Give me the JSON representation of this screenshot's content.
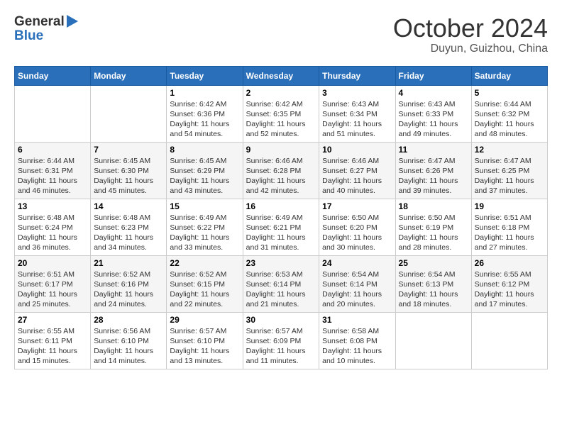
{
  "logo": {
    "text_general": "General",
    "text_blue": "Blue"
  },
  "title": "October 2024",
  "location": "Duyun, Guizhou, China",
  "weekdays": [
    "Sunday",
    "Monday",
    "Tuesday",
    "Wednesday",
    "Thursday",
    "Friday",
    "Saturday"
  ],
  "weeks": [
    [
      {
        "day": "",
        "info": ""
      },
      {
        "day": "",
        "info": ""
      },
      {
        "day": "1",
        "info": "Sunrise: 6:42 AM\nSunset: 6:36 PM\nDaylight: 11 hours and 54 minutes."
      },
      {
        "day": "2",
        "info": "Sunrise: 6:42 AM\nSunset: 6:35 PM\nDaylight: 11 hours and 52 minutes."
      },
      {
        "day": "3",
        "info": "Sunrise: 6:43 AM\nSunset: 6:34 PM\nDaylight: 11 hours and 51 minutes."
      },
      {
        "day": "4",
        "info": "Sunrise: 6:43 AM\nSunset: 6:33 PM\nDaylight: 11 hours and 49 minutes."
      },
      {
        "day": "5",
        "info": "Sunrise: 6:44 AM\nSunset: 6:32 PM\nDaylight: 11 hours and 48 minutes."
      }
    ],
    [
      {
        "day": "6",
        "info": "Sunrise: 6:44 AM\nSunset: 6:31 PM\nDaylight: 11 hours and 46 minutes."
      },
      {
        "day": "7",
        "info": "Sunrise: 6:45 AM\nSunset: 6:30 PM\nDaylight: 11 hours and 45 minutes."
      },
      {
        "day": "8",
        "info": "Sunrise: 6:45 AM\nSunset: 6:29 PM\nDaylight: 11 hours and 43 minutes."
      },
      {
        "day": "9",
        "info": "Sunrise: 6:46 AM\nSunset: 6:28 PM\nDaylight: 11 hours and 42 minutes."
      },
      {
        "day": "10",
        "info": "Sunrise: 6:46 AM\nSunset: 6:27 PM\nDaylight: 11 hours and 40 minutes."
      },
      {
        "day": "11",
        "info": "Sunrise: 6:47 AM\nSunset: 6:26 PM\nDaylight: 11 hours and 39 minutes."
      },
      {
        "day": "12",
        "info": "Sunrise: 6:47 AM\nSunset: 6:25 PM\nDaylight: 11 hours and 37 minutes."
      }
    ],
    [
      {
        "day": "13",
        "info": "Sunrise: 6:48 AM\nSunset: 6:24 PM\nDaylight: 11 hours and 36 minutes."
      },
      {
        "day": "14",
        "info": "Sunrise: 6:48 AM\nSunset: 6:23 PM\nDaylight: 11 hours and 34 minutes."
      },
      {
        "day": "15",
        "info": "Sunrise: 6:49 AM\nSunset: 6:22 PM\nDaylight: 11 hours and 33 minutes."
      },
      {
        "day": "16",
        "info": "Sunrise: 6:49 AM\nSunset: 6:21 PM\nDaylight: 11 hours and 31 minutes."
      },
      {
        "day": "17",
        "info": "Sunrise: 6:50 AM\nSunset: 6:20 PM\nDaylight: 11 hours and 30 minutes."
      },
      {
        "day": "18",
        "info": "Sunrise: 6:50 AM\nSunset: 6:19 PM\nDaylight: 11 hours and 28 minutes."
      },
      {
        "day": "19",
        "info": "Sunrise: 6:51 AM\nSunset: 6:18 PM\nDaylight: 11 hours and 27 minutes."
      }
    ],
    [
      {
        "day": "20",
        "info": "Sunrise: 6:51 AM\nSunset: 6:17 PM\nDaylight: 11 hours and 25 minutes."
      },
      {
        "day": "21",
        "info": "Sunrise: 6:52 AM\nSunset: 6:16 PM\nDaylight: 11 hours and 24 minutes."
      },
      {
        "day": "22",
        "info": "Sunrise: 6:52 AM\nSunset: 6:15 PM\nDaylight: 11 hours and 22 minutes."
      },
      {
        "day": "23",
        "info": "Sunrise: 6:53 AM\nSunset: 6:14 PM\nDaylight: 11 hours and 21 minutes."
      },
      {
        "day": "24",
        "info": "Sunrise: 6:54 AM\nSunset: 6:14 PM\nDaylight: 11 hours and 20 minutes."
      },
      {
        "day": "25",
        "info": "Sunrise: 6:54 AM\nSunset: 6:13 PM\nDaylight: 11 hours and 18 minutes."
      },
      {
        "day": "26",
        "info": "Sunrise: 6:55 AM\nSunset: 6:12 PM\nDaylight: 11 hours and 17 minutes."
      }
    ],
    [
      {
        "day": "27",
        "info": "Sunrise: 6:55 AM\nSunset: 6:11 PM\nDaylight: 11 hours and 15 minutes."
      },
      {
        "day": "28",
        "info": "Sunrise: 6:56 AM\nSunset: 6:10 PM\nDaylight: 11 hours and 14 minutes."
      },
      {
        "day": "29",
        "info": "Sunrise: 6:57 AM\nSunset: 6:10 PM\nDaylight: 11 hours and 13 minutes."
      },
      {
        "day": "30",
        "info": "Sunrise: 6:57 AM\nSunset: 6:09 PM\nDaylight: 11 hours and 11 minutes."
      },
      {
        "day": "31",
        "info": "Sunrise: 6:58 AM\nSunset: 6:08 PM\nDaylight: 11 hours and 10 minutes."
      },
      {
        "day": "",
        "info": ""
      },
      {
        "day": "",
        "info": ""
      }
    ]
  ]
}
